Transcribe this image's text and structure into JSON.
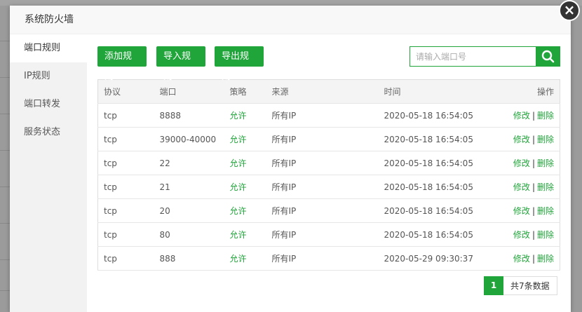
{
  "modal": {
    "title": "系统防火墙"
  },
  "sidebar": {
    "items": [
      {
        "label": "端口规则"
      },
      {
        "label": "IP规则"
      },
      {
        "label": "端口转发"
      },
      {
        "label": "服务状态"
      }
    ]
  },
  "toolbar": {
    "add_label": "添加规则",
    "import_label": "导入规则",
    "export_label": "导出规则",
    "search_placeholder": "请输入端口号"
  },
  "table": {
    "headers": [
      "协议",
      "端口",
      "策略",
      "来源",
      "时间",
      "操作"
    ],
    "rows": [
      {
        "protocol": "tcp",
        "port": "8888",
        "policy": "允许",
        "source": "所有IP",
        "time": "2020-05-18 16:54:05",
        "edit": "修改",
        "sep": "|",
        "delete": "删除"
      },
      {
        "protocol": "tcp",
        "port": "39000-40000",
        "policy": "允许",
        "source": "所有IP",
        "time": "2020-05-18 16:54:05",
        "edit": "修改",
        "sep": "|",
        "delete": "删除"
      },
      {
        "protocol": "tcp",
        "port": "22",
        "policy": "允许",
        "source": "所有IP",
        "time": "2020-05-18 16:54:05",
        "edit": "修改",
        "sep": "|",
        "delete": "删除"
      },
      {
        "protocol": "tcp",
        "port": "21",
        "policy": "允许",
        "source": "所有IP",
        "time": "2020-05-18 16:54:05",
        "edit": "修改",
        "sep": "|",
        "delete": "删除"
      },
      {
        "protocol": "tcp",
        "port": "20",
        "policy": "允许",
        "source": "所有IP",
        "time": "2020-05-18 16:54:05",
        "edit": "修改",
        "sep": "|",
        "delete": "删除"
      },
      {
        "protocol": "tcp",
        "port": "80",
        "policy": "允许",
        "source": "所有IP",
        "time": "2020-05-18 16:54:05",
        "edit": "修改",
        "sep": "|",
        "delete": "删除"
      },
      {
        "protocol": "tcp",
        "port": "888",
        "policy": "允许",
        "source": "所有IP",
        "time": "2020-05-29 09:30:37",
        "edit": "修改",
        "sep": "|",
        "delete": "删除"
      }
    ]
  },
  "pagination": {
    "current": "1",
    "total_text": "共7条数据"
  },
  "icons": {
    "close": "close-icon",
    "search": "search-icon"
  },
  "colors": {
    "accent": "#20a53a"
  }
}
